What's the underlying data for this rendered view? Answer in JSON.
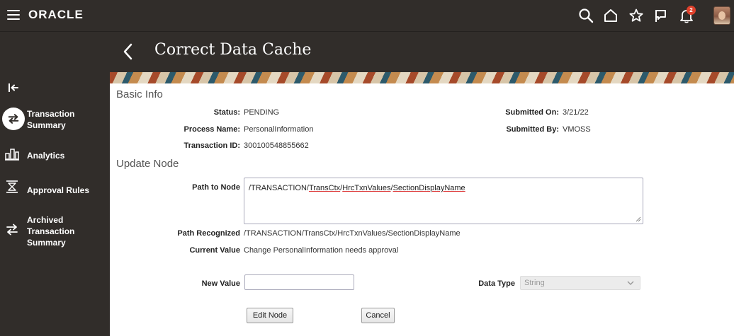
{
  "header": {
    "logo": "ORACLE",
    "notification_count": "2",
    "icons": [
      "hamburger-icon",
      "search-icon",
      "home-icon",
      "star-icon",
      "flag-icon",
      "bell-icon"
    ]
  },
  "sidebar": {
    "items": [
      {
        "label": "Transaction Summary",
        "icon": "swap-arrows-icon",
        "active": true
      },
      {
        "label": "Analytics",
        "icon": "analytics-icon",
        "active": false
      },
      {
        "label": "Approval Rules",
        "icon": "approval-rules-icon",
        "active": false
      },
      {
        "label": "Archived Transaction Summary",
        "icon": "archived-swap-icon",
        "active": false
      }
    ]
  },
  "page": {
    "title": "Correct Data Cache"
  },
  "basic_info": {
    "heading": "Basic Info",
    "status_label": "Status:",
    "status_value": "PENDING",
    "process_label": "Process Name:",
    "process_value": "PersonalInformation",
    "txn_label": "Transaction ID:",
    "txn_value": "300100548855662",
    "submitted_on_label": "Submitted On:",
    "submitted_on_value": "3/21/22",
    "submitted_by_label": "Submitted By:",
    "submitted_by_value": "VMOSS"
  },
  "update_node": {
    "heading": "Update Node",
    "path_label": "Path to Node",
    "path_segments": [
      "/TRANSACTION/",
      "TransCtx",
      "/",
      "HrcTxnValues",
      "/",
      "SectionDisplayName"
    ],
    "path_recognized_label": "Path Recognized",
    "path_recognized_value": "/TRANSACTION/TransCtx/HrcTxnValues/SectionDisplayName",
    "current_value_label": "Current Value",
    "current_value": "Change PersonalInformation needs approval",
    "new_value_label": "New Value",
    "new_value": "",
    "data_type_label": "Data Type",
    "data_type_value": "String",
    "edit_button": "Edit Node",
    "cancel_button": "Cancel"
  }
}
